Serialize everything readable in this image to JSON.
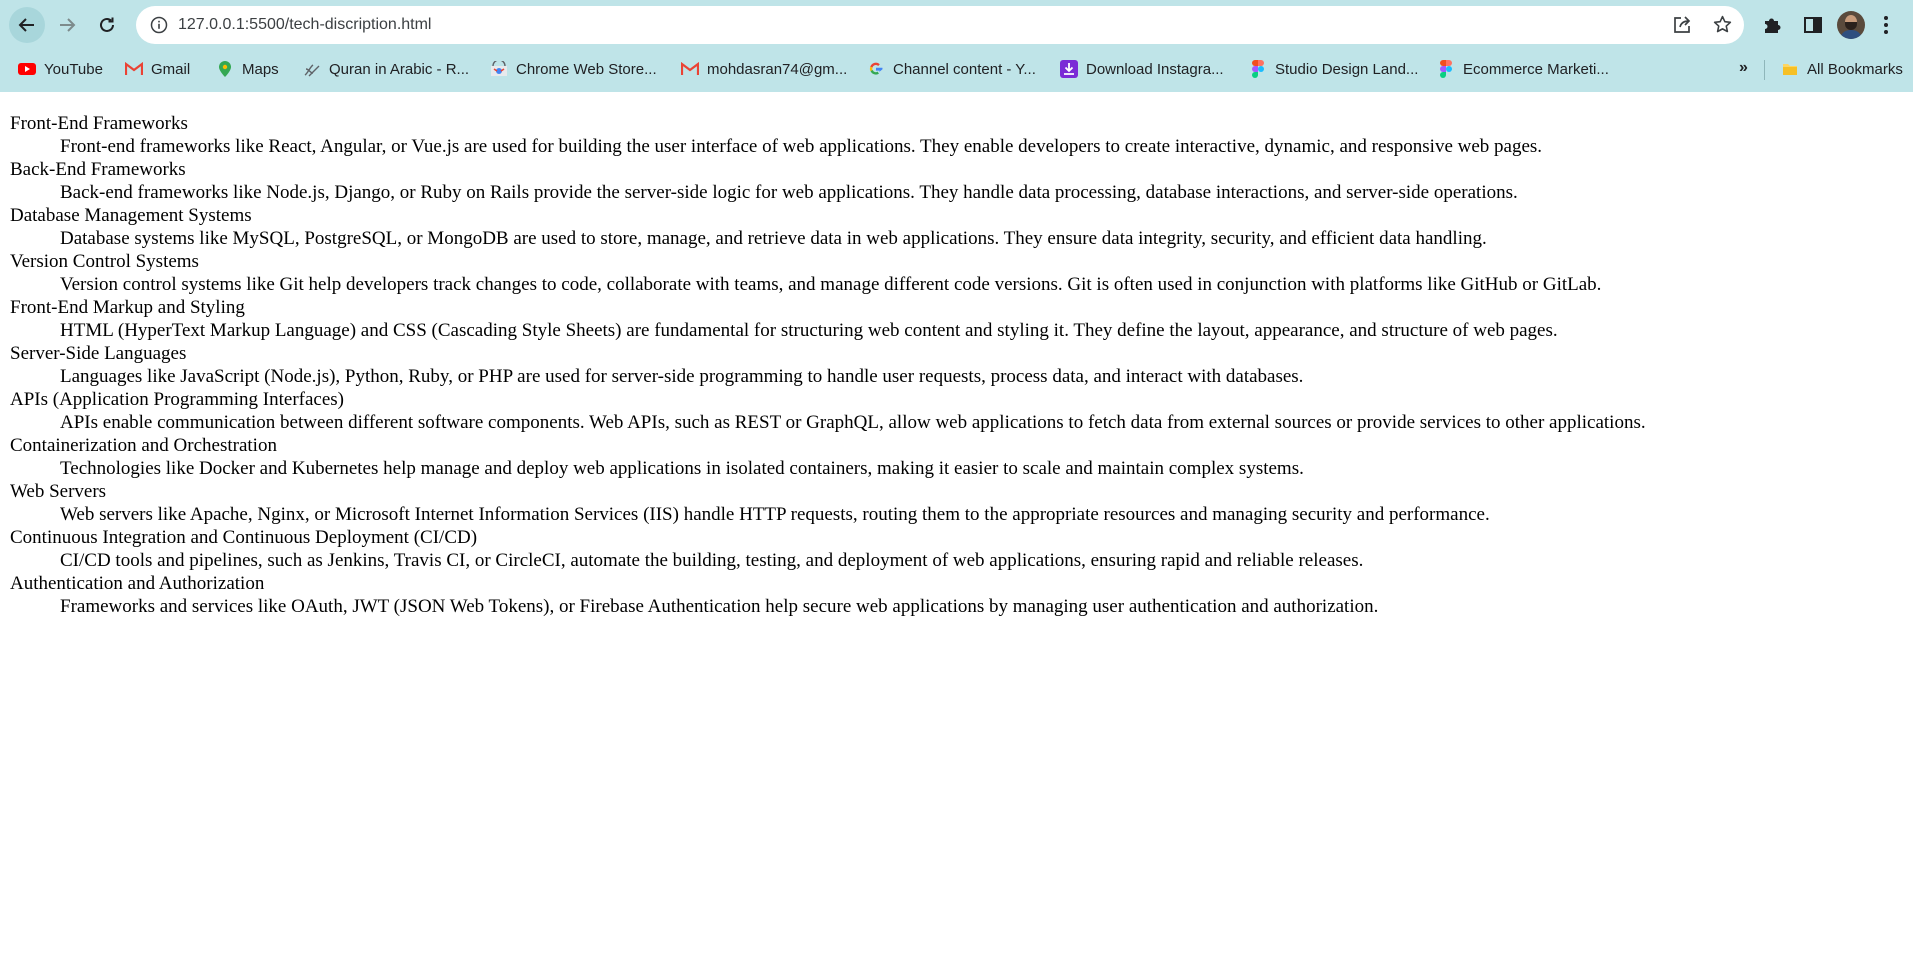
{
  "browser": {
    "url": "127.0.0.1:5500/tech-discription.html",
    "bookmarks": [
      {
        "label": "YouTube",
        "icon": "youtube-icon"
      },
      {
        "label": "Gmail",
        "icon": "gmail-icon"
      },
      {
        "label": "Maps",
        "icon": "maps-icon"
      },
      {
        "label": "Quran in Arabic - R...",
        "icon": "quran-icon"
      },
      {
        "label": "Chrome Web Store...",
        "icon": "chrome-web-store-icon"
      },
      {
        "label": "mohdasran74@gm...",
        "icon": "gmail-icon"
      },
      {
        "label": "Channel content - Y...",
        "icon": "google-icon"
      },
      {
        "label": "Download Instagra...",
        "icon": "download-icon"
      },
      {
        "label": "Studio Design Land...",
        "icon": "figma-icon"
      },
      {
        "label": "Ecommerce Marketi...",
        "icon": "figma-icon"
      }
    ],
    "more_bookmarks": "»",
    "all_bookmarks": "All Bookmarks"
  },
  "colors": {
    "chrome_bg": "#bfe4e8",
    "youtube_red": "#ff0000",
    "gmail_red": "#ea4335",
    "download_purple": "#7b2bd6"
  },
  "content": {
    "items": [
      {
        "term": "Front-End Frameworks",
        "description": "Front-end frameworks like React, Angular, or Vue.js are used for building the user interface of web applications. They enable developers to create interactive, dynamic, and responsive web pages."
      },
      {
        "term": "Back-End Frameworks",
        "description": "Back-end frameworks like Node.js, Django, or Ruby on Rails provide the server-side logic for web applications. They handle data processing, database interactions, and server-side operations."
      },
      {
        "term": "Database Management Systems",
        "description": "Database systems like MySQL, PostgreSQL, or MongoDB are used to store, manage, and retrieve data in web applications. They ensure data integrity, security, and efficient data handling."
      },
      {
        "term": "Version Control Systems",
        "description": "Version control systems like Git help developers track changes to code, collaborate with teams, and manage different code versions. Git is often used in conjunction with platforms like GitHub or GitLab."
      },
      {
        "term": "Front-End Markup and Styling",
        "description": "HTML (HyperText Markup Language) and CSS (Cascading Style Sheets) are fundamental for structuring web content and styling it. They define the layout, appearance, and structure of web pages."
      },
      {
        "term": "Server-Side Languages",
        "description": "Languages like JavaScript (Node.js), Python, Ruby, or PHP are used for server-side programming to handle user requests, process data, and interact with databases."
      },
      {
        "term": "APIs (Application Programming Interfaces)",
        "description": "APIs enable communication between different software components. Web APIs, such as REST or GraphQL, allow web applications to fetch data from external sources or provide services to other applications."
      },
      {
        "term": "Containerization and Orchestration",
        "description": "Technologies like Docker and Kubernetes help manage and deploy web applications in isolated containers, making it easier to scale and maintain complex systems."
      },
      {
        "term": "Web Servers",
        "description": "Web servers like Apache, Nginx, or Microsoft Internet Information Services (IIS) handle HTTP requests, routing them to the appropriate resources and managing security and performance."
      },
      {
        "term": "Continuous Integration and Continuous Deployment (CI/CD)",
        "description": "CI/CD tools and pipelines, such as Jenkins, Travis CI, or CircleCI, automate the building, testing, and deployment of web applications, ensuring rapid and reliable releases."
      },
      {
        "term": "Authentication and Authorization",
        "description": "Frameworks and services like OAuth, JWT (JSON Web Tokens), or Firebase Authentication help secure web applications by managing user authentication and authorization."
      }
    ]
  }
}
